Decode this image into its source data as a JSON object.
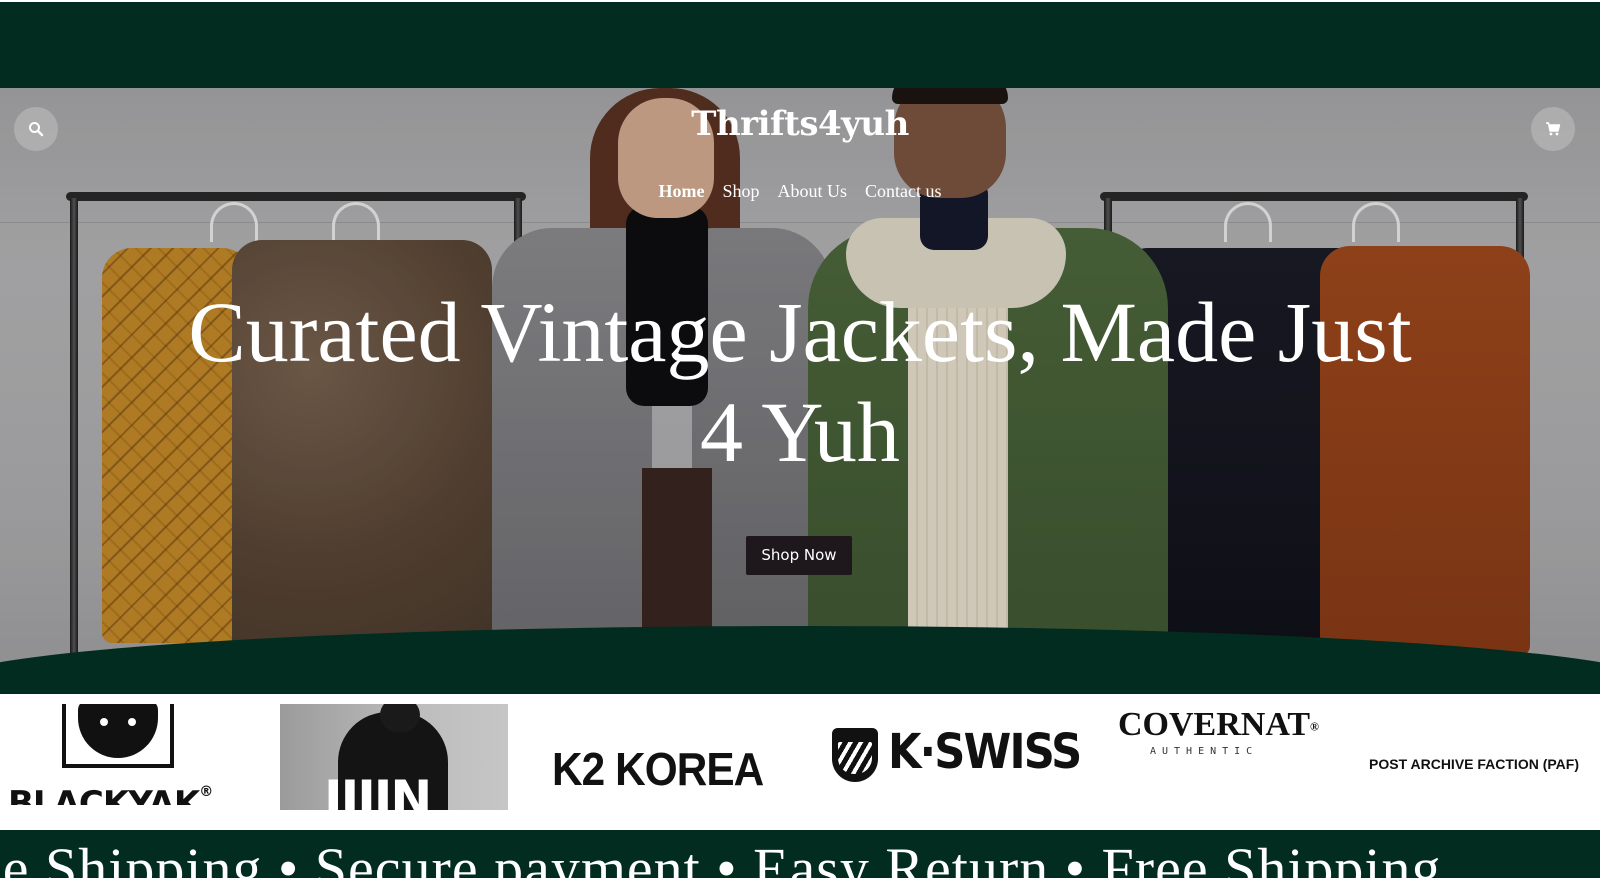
{
  "header": {
    "brand": "Thrifts4yuh",
    "nav": [
      {
        "label": "Home"
      },
      {
        "label": "Shop"
      },
      {
        "label": "About Us"
      },
      {
        "label": "Contact us"
      }
    ],
    "active_nav": "Home",
    "search_icon": "search-icon",
    "cart_icon": "cart-icon"
  },
  "hero": {
    "title_line1": "Curated Vintage Jackets, Made Just",
    "title_line2": "4 Yuh",
    "cta": "Shop Now"
  },
  "brands": {
    "blackyak": "BLACKYAK",
    "blackyak_mark": "®",
    "photo_text": "JJJJN",
    "k2": "K2 KOREA",
    "kswiss": "K·SWISS",
    "covernat": "COVERNAT",
    "covernat_mark": "®",
    "covernat_sub": "AUTHENTIC",
    "paf": "POST ARCHIVE FACTION (PAF)"
  },
  "marquee": {
    "text": "ee Shipping • Secure payment • Easy Return • Free Shipping"
  },
  "colors": {
    "brand_green": "#022c1f",
    "cta_dark": "#1e171b",
    "white": "#ffffff"
  }
}
